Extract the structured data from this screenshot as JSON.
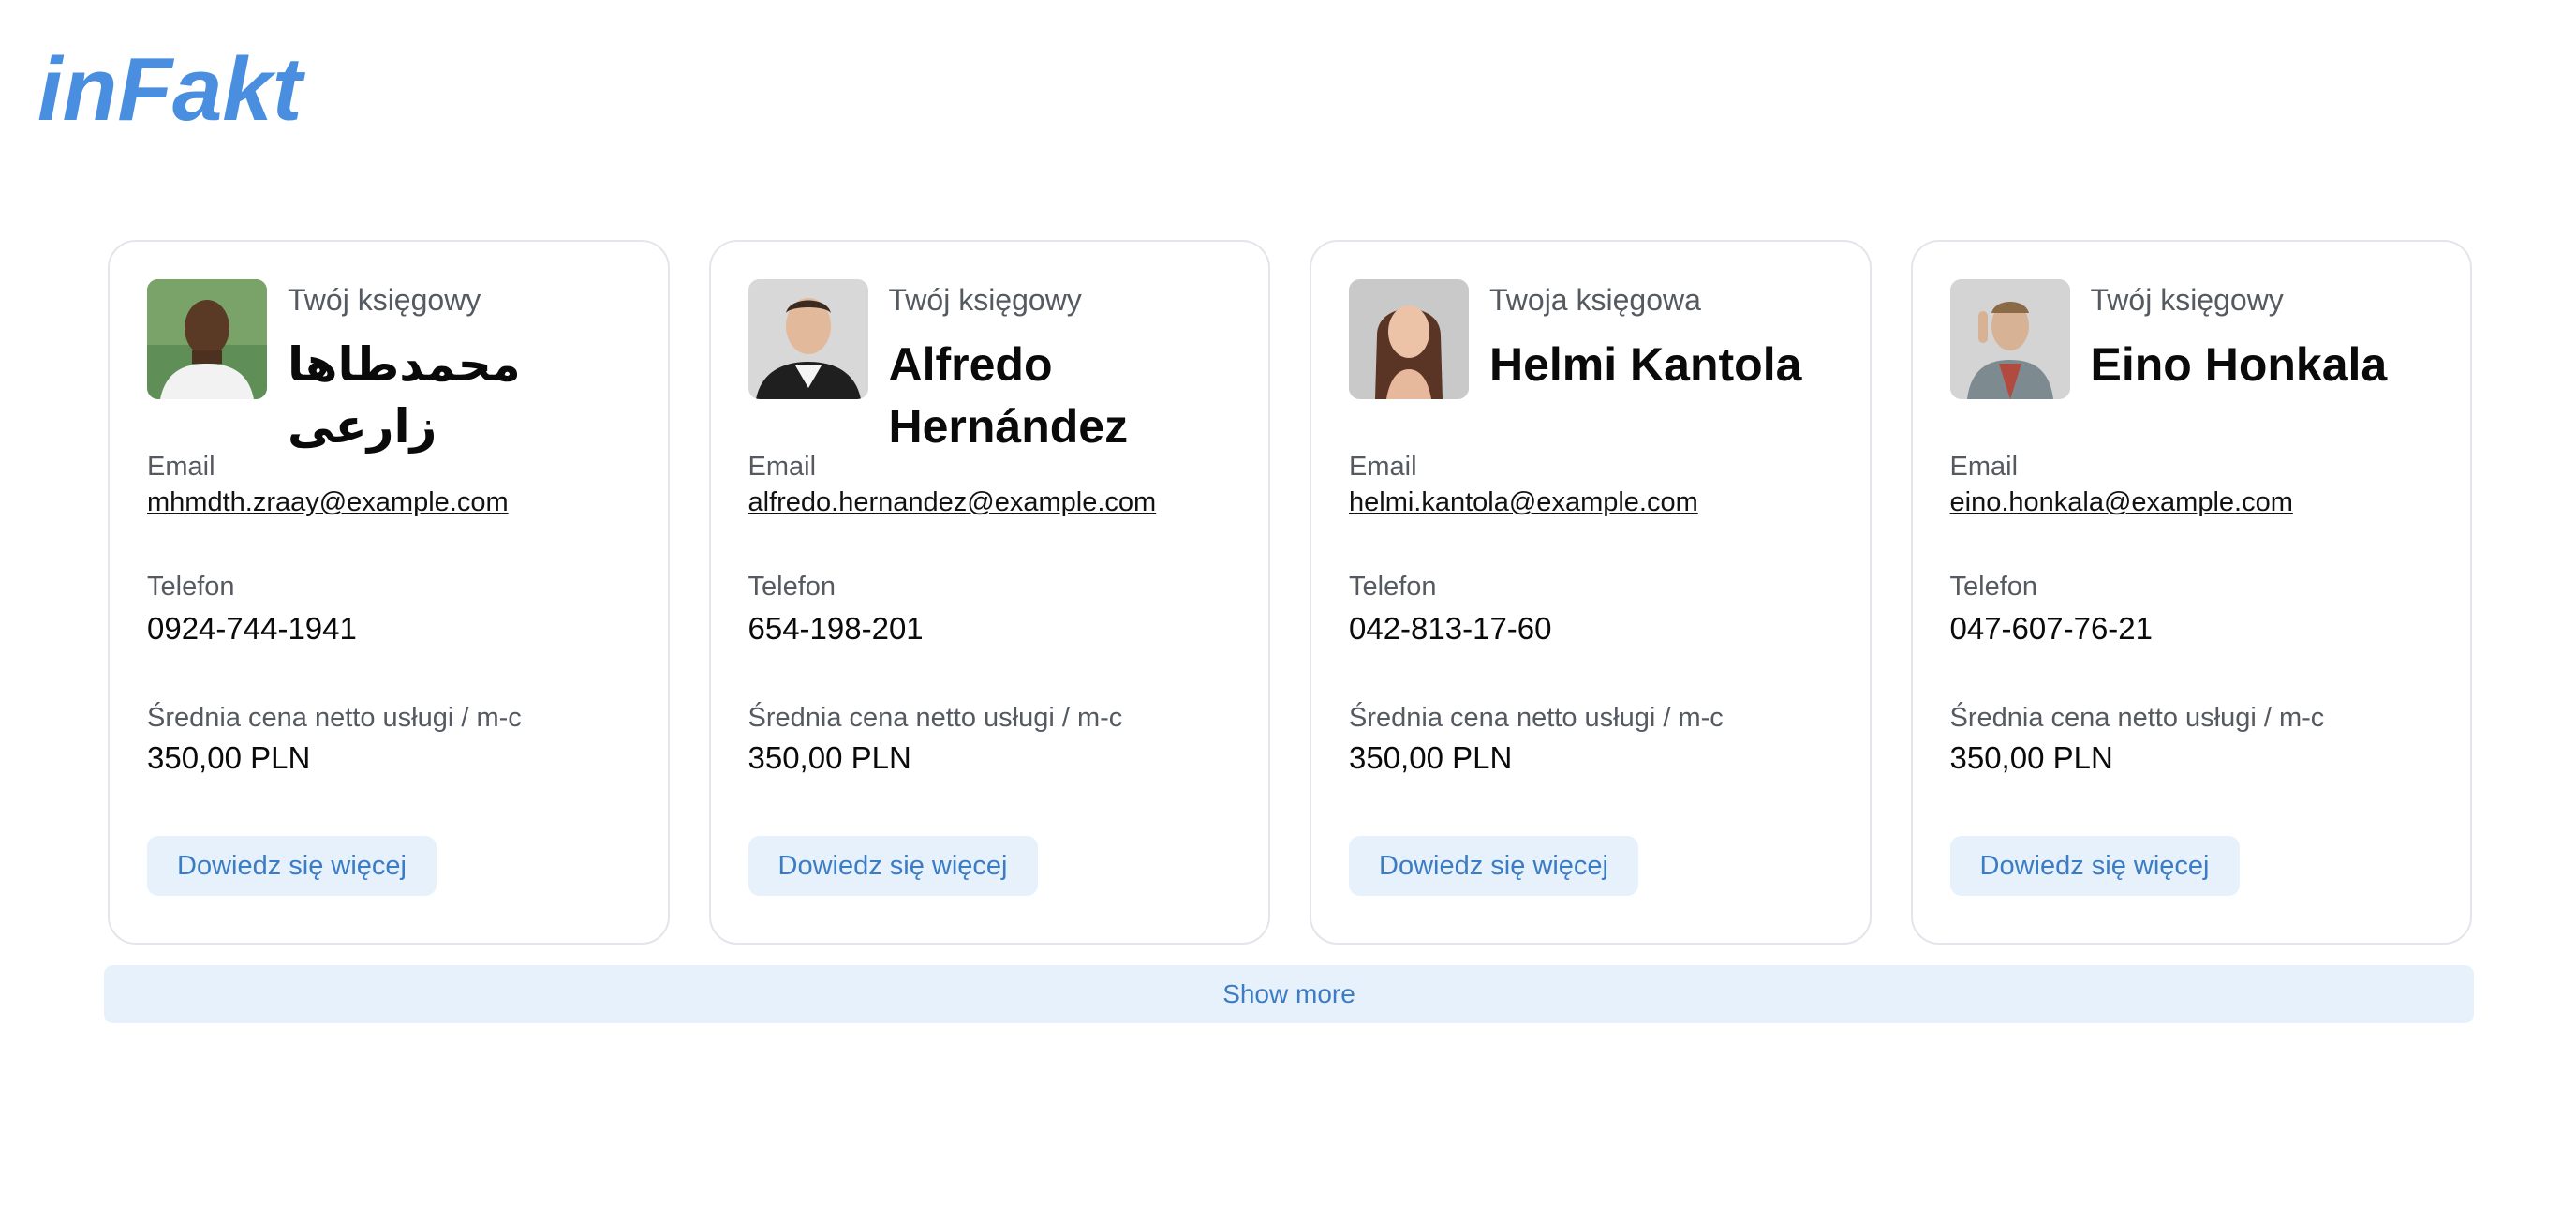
{
  "brand": {
    "logo_text": "inFakt",
    "color": "#4a8ee0"
  },
  "cards": [
    {
      "role": "Twój księgowy",
      "name": "محمدطاها زارعی",
      "email_label": "Email",
      "email": "mhmdth.zraay@example.com",
      "phone_label": "Telefon",
      "phone": "0924-744-1941",
      "price_label": "Średnia cena netto usługi / m-c",
      "price": "350,00 PLN",
      "button_label": "Dowiedz się więcej"
    },
    {
      "role": "Twój księgowy",
      "name": "Alfredo Hernández",
      "email_label": "Email",
      "email": "alfredo.hernandez@example.com",
      "phone_label": "Telefon",
      "phone": "654-198-201",
      "price_label": "Średnia cena netto usługi / m-c",
      "price": "350,00 PLN",
      "button_label": "Dowiedz się więcej"
    },
    {
      "role": "Twoja księgowa",
      "name": "Helmi Kantola",
      "email_label": "Email",
      "email": "helmi.kantola@example.com",
      "phone_label": "Telefon",
      "phone": "042-813-17-60",
      "price_label": "Średnia cena netto usługi / m-c",
      "price": "350,00 PLN",
      "button_label": "Dowiedz się więcej"
    },
    {
      "role": "Twój księgowy",
      "name": "Eino Honkala",
      "email_label": "Email",
      "email": "eino.honkala@example.com",
      "phone_label": "Telefon",
      "phone": "047-607-76-21",
      "price_label": "Średnia cena netto usługi / m-c",
      "price": "350,00 PLN",
      "button_label": "Dowiedz się więcej"
    }
  ],
  "show_more_label": "Show more",
  "colors": {
    "accent_text": "#3b7cc4",
    "button_bg": "#e6f1fb",
    "card_border": "#e2e5ea",
    "muted_text": "#555a61"
  }
}
